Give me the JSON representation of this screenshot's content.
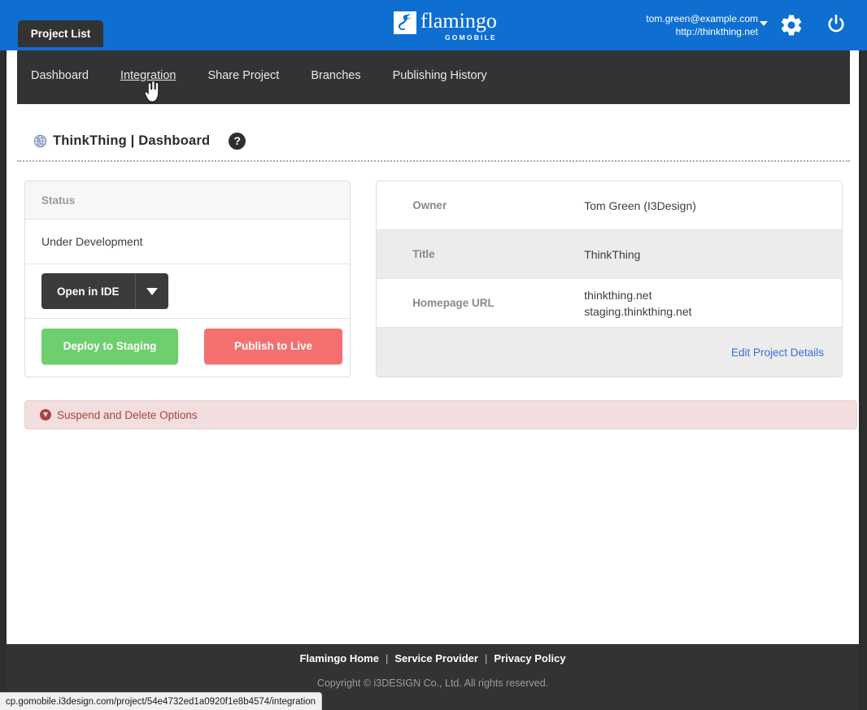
{
  "topbar": {
    "logo": {
      "mark_icon": "flamingo-logo-icon",
      "word": "flamingo",
      "sub": "GOMOBILE"
    },
    "user_email": "tom.green@example.com",
    "user_site": "http://thinkthing.net",
    "dropdown_icon": "caret-down-icon",
    "settings_icon": "gear-icon",
    "logout_icon": "power-icon",
    "brand_color": "#0f6fd0"
  },
  "project_tab": {
    "label": "Project List"
  },
  "nav": {
    "items": [
      {
        "label": "Dashboard",
        "active": false
      },
      {
        "label": "Integration",
        "active": true
      },
      {
        "label": "Share Project",
        "active": false
      },
      {
        "label": "Branches",
        "active": false
      },
      {
        "label": "Publishing History",
        "active": false
      }
    ]
  },
  "page_header": {
    "globe_icon": "globe-icon",
    "title": "ThinkThing | Dashboard",
    "help_icon": "help-icon",
    "help_glyph": "?"
  },
  "status_panel": {
    "head": "Status",
    "value": "Under Development",
    "open_in_ide_label": "Open in IDE",
    "open_in_ide_caret_icon": "caret-down-icon",
    "deploy_label": "Deploy to Staging",
    "publish_label": "Publish to Live",
    "deploy_color": "#6ecf6e",
    "publish_color": "#f4706e"
  },
  "details_panel": {
    "rows": [
      {
        "label": "Owner",
        "values": [
          "Tom Green (I3Design)"
        ]
      },
      {
        "label": "Title",
        "values": [
          "ThinkThing"
        ]
      },
      {
        "label": "Homepage URL",
        "values": [
          "thinkthing.net",
          "staging.thinkthing.net"
        ]
      }
    ],
    "edit_link": "Edit Project Details"
  },
  "alert": {
    "icon": "circle-arrow-down-icon",
    "text": "Suspend and Delete Options",
    "bg_color": "#f2dede",
    "text_color": "#a94442"
  },
  "footer": {
    "links": [
      "Flamingo Home",
      "Service Provider",
      "Privacy Policy"
    ],
    "separator": "|",
    "copyright": "Copyright © i3DESIGN Co., Ltd. All rights reserved."
  },
  "status_url": "cp.gomobile.i3design.com/project/54e4732ed1a0920f1e8b4574/integration"
}
